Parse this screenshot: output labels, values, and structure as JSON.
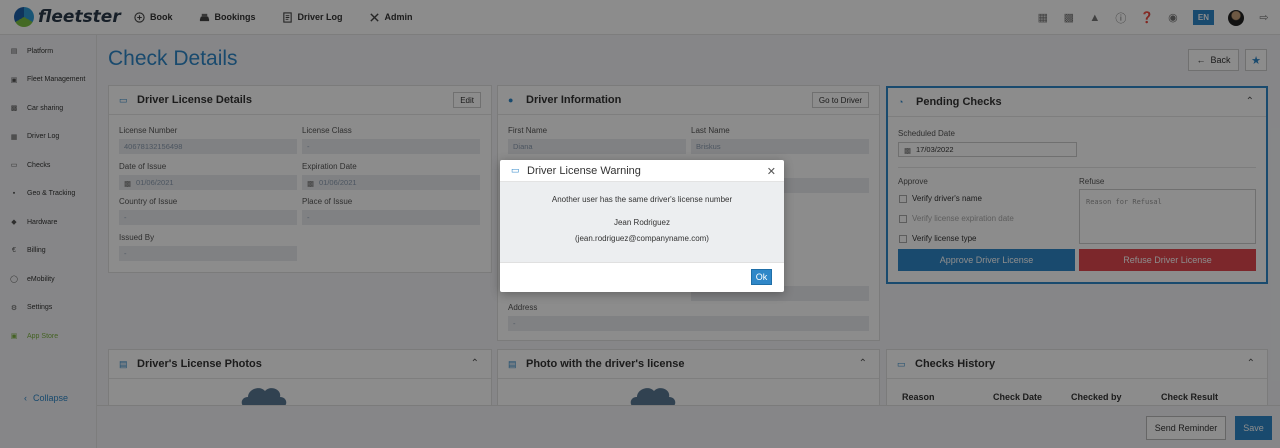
{
  "app": {
    "name": "fleetster"
  },
  "topnav": [
    {
      "label": "Book",
      "icon": "plus-circle-icon"
    },
    {
      "label": "Bookings",
      "icon": "car-icon"
    },
    {
      "label": "Driver Log",
      "icon": "document-icon"
    },
    {
      "label": "Admin",
      "icon": "tools-icon"
    }
  ],
  "topright": {
    "language": "EN"
  },
  "sidebar": {
    "items": [
      {
        "label": "Platform",
        "icon": "clipboard-icon"
      },
      {
        "label": "Fleet Management",
        "icon": "truck-icon"
      },
      {
        "label": "Car sharing",
        "icon": "car-share-icon"
      },
      {
        "label": "Driver Log",
        "icon": "log-icon"
      },
      {
        "label": "Checks",
        "icon": "id-card-icon"
      },
      {
        "label": "Geo & Tracking",
        "icon": "map-icon"
      },
      {
        "label": "Hardware",
        "icon": "hardware-icon"
      },
      {
        "label": "Billing",
        "icon": "euro-icon"
      },
      {
        "label": "eMobility",
        "icon": "emobility-icon"
      },
      {
        "label": "Settings",
        "icon": "gear-icon"
      },
      {
        "label": "App Store",
        "icon": "app-store-icon"
      }
    ],
    "collapse_label": "Collapse"
  },
  "page": {
    "title": "Check Details",
    "back_label": "Back"
  },
  "license_card": {
    "title": "Driver License Details",
    "edit_label": "Edit",
    "fields": {
      "license_number": {
        "label": "License Number",
        "value": "40678132156498"
      },
      "license_class": {
        "label": "License Class",
        "value": "-"
      },
      "date_of_issue": {
        "label": "Date of Issue",
        "value": "01/06/2021"
      },
      "expiration_date": {
        "label": "Expiration Date",
        "value": "01/06/2021"
      },
      "country_of_issue": {
        "label": "Country of Issue",
        "value": "-"
      },
      "place_of_issue": {
        "label": "Place of Issue",
        "value": "-"
      },
      "issued_by": {
        "label": "Issued By",
        "value": "-"
      }
    }
  },
  "driver_card": {
    "title": "Driver Information",
    "goto_label": "Go to Driver",
    "fields": {
      "first_name": {
        "label": "First Name",
        "value": "Diana"
      },
      "last_name": {
        "label": "Last Name",
        "value": "Briskus"
      },
      "address": {
        "label": "Address",
        "value": "-"
      }
    }
  },
  "pending_card": {
    "title": "Pending Checks",
    "scheduled_label": "Scheduled Date",
    "scheduled_value": "17/03/2022",
    "approve_label": "Approve",
    "refuse_label": "Refuse",
    "checks": [
      "Verify driver's name",
      "Verify license expiration date",
      "Verify license type"
    ],
    "refusal_placeholder": "Reason for Refusal",
    "approve_button": "Approve Driver License",
    "refuse_button": "Refuse Driver License"
  },
  "photos_card": {
    "title": "Driver's License Photos"
  },
  "photo_with_card": {
    "title": "Photo with the driver's license"
  },
  "history_card": {
    "title": "Checks History",
    "columns": [
      "Reason",
      "Check Date",
      "Checked by",
      "Check Result"
    ]
  },
  "footer": {
    "send_reminder": "Send Reminder",
    "save": "Save"
  },
  "modal": {
    "title": "Driver License Warning",
    "message": "Another user has the same driver's license number",
    "name": "Jean Rodriguez",
    "email": "(jean.rodriguez@companyname.com)",
    "ok_label": "Ok"
  }
}
